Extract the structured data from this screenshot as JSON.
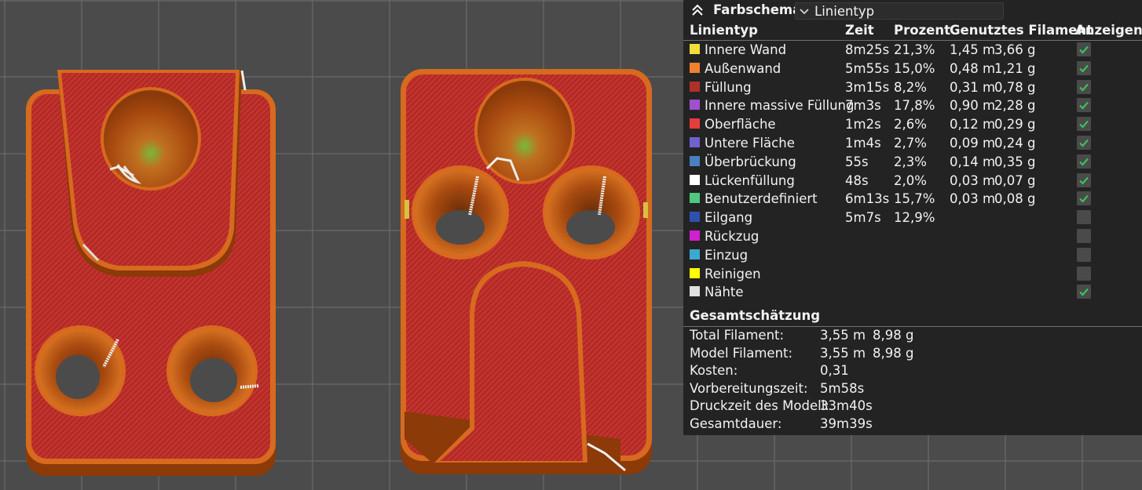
{
  "legend": {
    "scheme_title": "Farbschema",
    "scheme_value": "Linientyp",
    "headers": [
      "Linientyp",
      "Zeit",
      "Prozent",
      "Genutztes Filament",
      "Anzeigen"
    ],
    "rows": [
      {
        "name": "Innere Wand",
        "time": "8m25s",
        "percent": "21,3%",
        "length": "1,45 m",
        "weight": "3,66 g",
        "color": "#f2de3a",
        "visible": true
      },
      {
        "name": "Außenwand",
        "time": "5m55s",
        "percent": "15,0%",
        "length": "0,48 m",
        "weight": "1,21 g",
        "color": "#f08030",
        "visible": true
      },
      {
        "name": "Füllung",
        "time": "3m15s",
        "percent": "8,2%",
        "length": "0,31 m",
        "weight": "0,78 g",
        "color": "#b03028",
        "visible": true
      },
      {
        "name": "Innere massive Füllung",
        "time": "7m3s",
        "percent": "17,8%",
        "length": "0,90 m",
        "weight": "2,28 g",
        "color": "#a050d0",
        "visible": true
      },
      {
        "name": "Oberfläche",
        "time": "1m2s",
        "percent": "2,6%",
        "length": "0,12 m",
        "weight": "0,29 g",
        "color": "#e83c3c",
        "visible": true
      },
      {
        "name": "Untere Fläche",
        "time": "1m4s",
        "percent": "2,7%",
        "length": "0,09 m",
        "weight": "0,24 g",
        "color": "#7060d0",
        "visible": true
      },
      {
        "name": "Überbrückung",
        "time": "55s",
        "percent": "2,3%",
        "length": "0,14 m",
        "weight": "0,35 g",
        "color": "#4a80c0",
        "visible": true
      },
      {
        "name": "Lückenfüllung",
        "time": "48s",
        "percent": "2,0%",
        "length": "0,03 m",
        "weight": "0,07 g",
        "color": "#ffffff",
        "visible": true
      },
      {
        "name": "Benutzerdefiniert",
        "time": "6m13s",
        "percent": "15,7%",
        "length": "0,03 m",
        "weight": "0,08 g",
        "color": "#50c880",
        "visible": true
      },
      {
        "name": "Eilgang",
        "time": "5m7s",
        "percent": "12,9%",
        "length": "",
        "weight": "",
        "color": "#3050b0",
        "visible": false
      },
      {
        "name": "Rückzug",
        "time": "",
        "percent": "",
        "length": "",
        "weight": "",
        "color": "#d020d0",
        "visible": false
      },
      {
        "name": "Einzug",
        "time": "",
        "percent": "",
        "length": "",
        "weight": "",
        "color": "#3aa8d0",
        "visible": false
      },
      {
        "name": "Reinigen",
        "time": "",
        "percent": "",
        "length": "",
        "weight": "",
        "color": "#ffff00",
        "visible": false
      },
      {
        "name": "Nähte",
        "time": "",
        "percent": "",
        "length": "",
        "weight": "",
        "color": "#e0e0e0",
        "visible": true
      }
    ],
    "summary_title": "Gesamtschätzung",
    "summary": [
      {
        "label": "Total Filament:",
        "v1": "3,55 m",
        "v2": "8,98 g"
      },
      {
        "label": "Model Filament:",
        "v1": "3,55 m",
        "v2": "8,98 g"
      },
      {
        "label": "Kosten:",
        "v1": "0,31",
        "v2": ""
      },
      {
        "label": "Vorbereitungszeit:",
        "v1": "5m58s",
        "v2": ""
      },
      {
        "label": "Druckzeit des Modell:",
        "v1": "33m40s",
        "v2": ""
      },
      {
        "label": "Gesamtdauer:",
        "v1": "39m39s",
        "v2": ""
      }
    ]
  }
}
